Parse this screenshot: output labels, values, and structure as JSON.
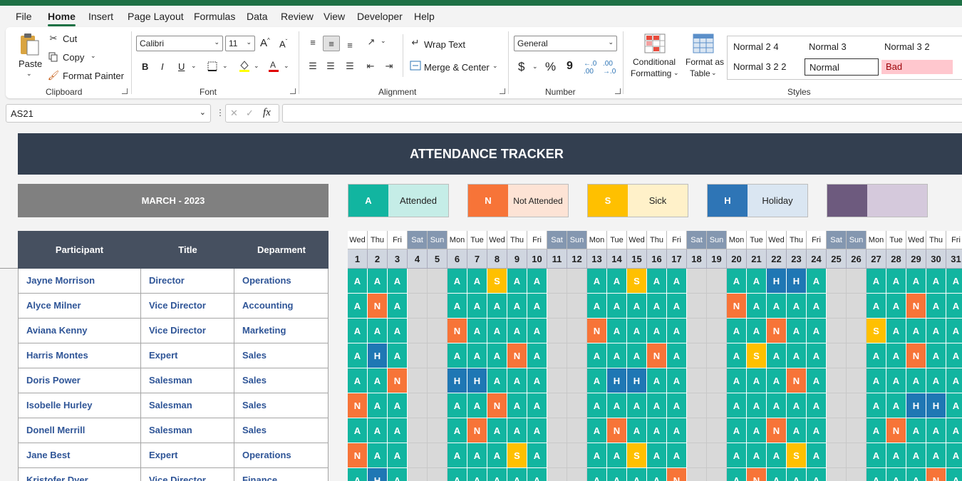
{
  "menu": [
    "File",
    "Home",
    "Insert",
    "Page Layout",
    "Formulas",
    "Data",
    "Review",
    "View",
    "Developer",
    "Help"
  ],
  "menu_active": "Home",
  "clipboard": {
    "paste": "Paste",
    "cut": "Cut",
    "copy": "Copy",
    "format_painter": "Format Painter",
    "label": "Clipboard"
  },
  "font": {
    "name": "Calibri",
    "size": "11",
    "label": "Font",
    "bold": "B",
    "italic": "I",
    "underline": "U"
  },
  "alignment": {
    "wrap_text": "Wrap Text",
    "merge_center": "Merge & Center",
    "label": "Alignment"
  },
  "number": {
    "format": "General",
    "label": "Number",
    "currency": "$",
    "percent": "%",
    "comma": "9"
  },
  "styles": {
    "conditional": [
      "Conditional",
      "Formatting"
    ],
    "format_table": [
      "Format as",
      "Table"
    ],
    "cells": [
      "Normal 2 4",
      "Normal 3",
      "Normal 3 2",
      "Normal 3 2 2",
      "Normal",
      "Bad"
    ],
    "label": "Styles"
  },
  "name_box": "AS21",
  "sheet": {
    "title": "ATTENDANCE TRACKER",
    "month": "MARCH - 2023",
    "legend": [
      {
        "code": "A",
        "desc": "Attended",
        "color": "#12b5a0",
        "bg": "#c5ede7"
      },
      {
        "code": "N",
        "desc": "Not Attended",
        "color": "#f77438",
        "bg": "#fde3d5"
      },
      {
        "code": "S",
        "desc": "Sick",
        "color": "#ffc000",
        "bg": "#fff1c9"
      },
      {
        "code": "H",
        "desc": "Holiday",
        "color": "#2e75b6",
        "bg": "#dae6f2"
      },
      {
        "code": "",
        "desc": "",
        "color": "#6d5a7e",
        "bg": "#d5c9dc"
      }
    ],
    "headers": [
      "Participant",
      "Title",
      "Deparment"
    ],
    "day_names": [
      "Wed",
      "Thu",
      "Fri",
      "Sat",
      "Sun",
      "Mon",
      "Tue",
      "Wed",
      "Thu",
      "Fri",
      "Sat",
      "Sun",
      "Mon",
      "Tue",
      "Wed",
      "Thu",
      "Fri",
      "Sat",
      "Sun",
      "Mon",
      "Tue",
      "Wed",
      "Thu",
      "Fri",
      "Sat",
      "Sun",
      "Mon",
      "Tue",
      "Wed",
      "Thu",
      "Fri"
    ],
    "day_numbers": [
      "1",
      "2",
      "3",
      "4",
      "5",
      "6",
      "7",
      "8",
      "9",
      "10",
      "11",
      "12",
      "13",
      "14",
      "15",
      "16",
      "17",
      "18",
      "19",
      "20",
      "21",
      "22",
      "23",
      "24",
      "25",
      "26",
      "27",
      "28",
      "29",
      "30",
      "31"
    ],
    "rows": [
      {
        "name": "Jayne Morrison",
        "title": "Director",
        "dept": "Operations",
        "marks": "AAA..AASAA..AASAA..AAHHA..AAAAA"
      },
      {
        "name": "Alyce Milner",
        "title": "Vice Director",
        "dept": "Accounting",
        "marks": "ANA..AAAAA..AAAAA..NAAAA..AANAA"
      },
      {
        "name": "Aviana Kenny",
        "title": "Vice Director",
        "dept": "Marketing",
        "marks": "AAA..NAAAA..NAAAA..AANAA..SAAAA"
      },
      {
        "name": "Harris Montes",
        "title": "Expert",
        "dept": "Sales",
        "marks": "AHA..AAANA..AAANA..ASAAA..AANAA"
      },
      {
        "name": "Doris Power",
        "title": "Salesman",
        "dept": "Sales",
        "marks": "AAN..HHAAA..AHHAA..AAANA..AAAAA"
      },
      {
        "name": "Isobelle Hurley",
        "title": "Salesman",
        "dept": "Sales",
        "marks": "NAA..AANAA..AAAAA..AAAAA..AAHHA"
      },
      {
        "name": "Donell Merrill",
        "title": "Salesman",
        "dept": "Sales",
        "marks": "AAA..ANAAA..ANAAA..AANAA..ANAAA"
      },
      {
        "name": "Jane Best",
        "title": "Expert",
        "dept": "Operations",
        "marks": "NAA..AAASA..AASAA..AAASA..AAAAA"
      },
      {
        "name": "Kristofer Dyer",
        "title": "Vice Director",
        "dept": "Finance",
        "marks": "AHA..AAAAA..AAAAN..ANAAA..AAANA"
      }
    ]
  }
}
